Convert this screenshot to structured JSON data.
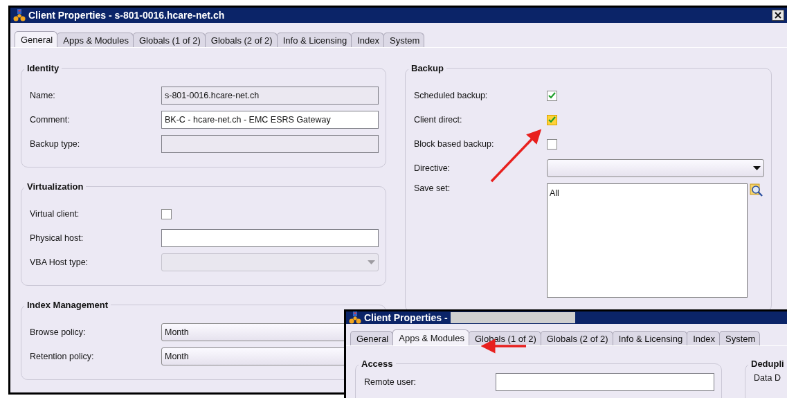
{
  "window": {
    "title": "Client Properties - s-801-0016.hcare-net.ch"
  },
  "tabs": [
    {
      "label": "General",
      "selected": true
    },
    {
      "label": "Apps & Modules",
      "selected": false
    },
    {
      "label": "Globals (1 of 2)",
      "selected": false
    },
    {
      "label": "Globals (2 of 2)",
      "selected": false
    },
    {
      "label": "Info & Licensing",
      "selected": false
    },
    {
      "label": "Index",
      "selected": false
    },
    {
      "label": "System",
      "selected": false
    }
  ],
  "left_groups": [
    {
      "title": "Identity",
      "fields": [
        {
          "label": "Name:",
          "kind": "text",
          "value": "s-801-0016.hcare-net.ch",
          "disabled": true
        },
        {
          "label": "Comment:",
          "kind": "text",
          "value": "BK-C - hcare-net.ch - EMC ESRS Gateway",
          "disabled": false
        },
        {
          "label": "Backup type:",
          "kind": "text",
          "disabled": true
        }
      ]
    },
    {
      "title": "Virtualization",
      "fields": [
        {
          "label": "Virtual client:",
          "kind": "checkbox",
          "checked": false
        },
        {
          "label": "Physical host:",
          "kind": "text",
          "disabled": false
        },
        {
          "label": "VBA Host type:",
          "kind": "select",
          "disabled": true
        }
      ]
    },
    {
      "title": "Index Management",
      "fields": [
        {
          "label": "Browse policy:",
          "kind": "select",
          "value": "Month",
          "disabled": false
        },
        {
          "label": "Retention policy:",
          "kind": "select",
          "value": "Month",
          "disabled": false
        }
      ]
    }
  ],
  "right_groups": [
    {
      "title": "Backup",
      "fields": [
        {
          "label": "Scheduled backup:",
          "kind": "checkbox",
          "checked": true
        },
        {
          "label": "Client direct:",
          "kind": "focused_checkbox",
          "checked": true
        },
        {
          "label": "Block based backup:",
          "kind": "checkbox",
          "checked": false
        },
        {
          "label": "Directive:",
          "kind": "select",
          "disabled": false
        },
        {
          "label": "Save set:",
          "kind": "textarea",
          "value": "All"
        }
      ]
    }
  ],
  "overlay_window": {
    "title": "Client Properties -",
    "title_redacted": true,
    "tabs": [
      {
        "label": "General",
        "selected": false
      },
      {
        "label": "Apps & Modules",
        "selected": true
      },
      {
        "label": "Globals (1 of 2)",
        "selected": false
      },
      {
        "label": "Globals (2 of 2)",
        "selected": false
      },
      {
        "label": "Info & Licensing",
        "selected": false
      },
      {
        "label": "Index",
        "selected": false
      },
      {
        "label": "System",
        "selected": false
      }
    ],
    "groups": [
      {
        "title": "Access",
        "fields": [
          {
            "label": "Remote user:",
            "kind": "text"
          }
        ]
      },
      {
        "title": "Dedupli",
        "fields": [
          {
            "label": "Data D",
            "kind": "label"
          }
        ]
      }
    ]
  }
}
